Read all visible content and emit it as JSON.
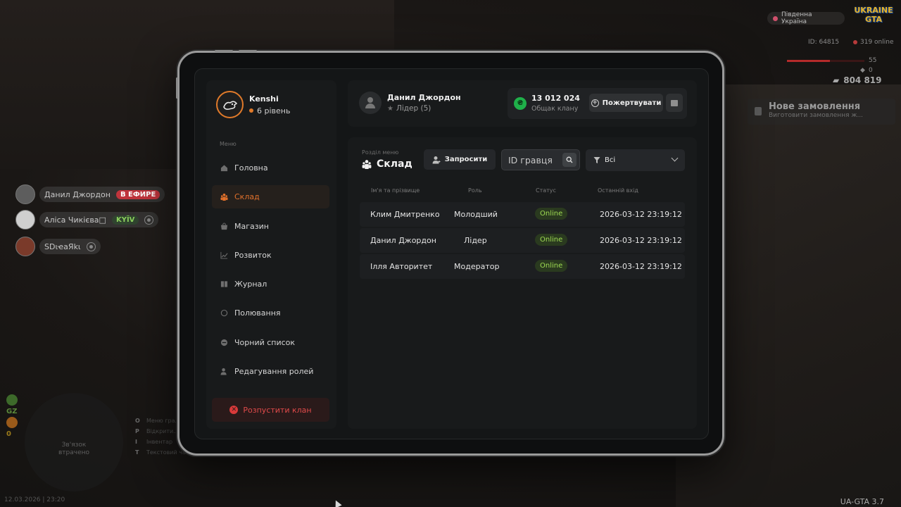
{
  "hud": {
    "server_name": "Південна Україна",
    "logo_text": "UKRAINE GTA",
    "player_id": "ID: 64815",
    "online": "319 online",
    "health": {
      "value": "55",
      "fraction": 0.55
    },
    "armor": "0",
    "money": "804 819",
    "notification": {
      "title": "Нове замовлення",
      "subtitle": "Виготовити замовлення ж..."
    }
  },
  "voice_chat": [
    {
      "name": "Данил Джордон",
      "badge": "В ЕФИРЕ",
      "badge_type": "live"
    },
    {
      "name": "Аліса Чикієва□",
      "badge": "KYÏV",
      "badge_type": "kyiv"
    },
    {
      "name": "ЅDɩҽaЯkɩ",
      "badge": "",
      "badge_type": "none"
    }
  ],
  "bottom_hud": {
    "minimap_text_1": "Зв'язок",
    "minimap_text_2": "втрачено",
    "side_labels": [
      "GZ",
      "0"
    ],
    "keys": [
      {
        "key": "O",
        "label": "Меню гра..."
      },
      {
        "key": "P",
        "label": "Відкрити..."
      },
      {
        "key": "I",
        "label": "Інвентар"
      },
      {
        "key": "T",
        "label": "Текстовий чат"
      }
    ],
    "datetime": "12.03.2026 | 23:20",
    "version": "UA-GTA 3.7"
  },
  "profile": {
    "name": "Kenshi",
    "level": "6 рівень"
  },
  "menu": {
    "title": "Меню",
    "items": [
      {
        "label": "Головна",
        "icon": "home-icon"
      },
      {
        "label": "Склад",
        "icon": "members-icon",
        "active": true
      },
      {
        "label": "Магазин",
        "icon": "shop-icon"
      },
      {
        "label": "Розвиток",
        "icon": "chart-icon"
      },
      {
        "label": "Журнал",
        "icon": "book-icon"
      },
      {
        "label": "Полювання",
        "icon": "target-icon"
      },
      {
        "label": "Чорний список",
        "icon": "block-icon"
      },
      {
        "label": "Редагування ролей",
        "icon": "user-edit-icon"
      }
    ],
    "disband_label": "Розпустити клан"
  },
  "header": {
    "leader_name": "Данил Джордон",
    "leader_role": "Лідер (5)",
    "balance_value": "13 012 024",
    "balance_label": "Общак клану",
    "donate_label": "Пожертвувати"
  },
  "section": {
    "subtitle": "Розділ меню",
    "title": "Склад",
    "invite_label": "Запросити",
    "search_placeholder": "ID гравця",
    "filter_label": "Всі"
  },
  "table": {
    "columns": [
      "Ім'я та прізвище",
      "Роль",
      "Статус",
      "Останній вхід"
    ],
    "rows": [
      {
        "name": "Клим Дмитренко",
        "role": "Молодший",
        "status": "Online",
        "last": "2026-03-12 23:19:12"
      },
      {
        "name": "Данил Джордон",
        "role": "Лідер",
        "status": "Online",
        "last": "2026-03-12 23:19:12"
      },
      {
        "name": "Ілля Авторитет",
        "role": "Модератор",
        "status": "Online",
        "last": "2026-03-12 23:19:12"
      }
    ]
  },
  "colors": {
    "accent": "#e2712b",
    "danger": "#e04a4a",
    "online": "#9edb52",
    "coin": "#1fb14a"
  }
}
